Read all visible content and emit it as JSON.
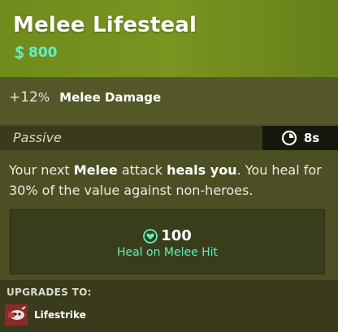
{
  "item": {
    "title": "Melee Lifesteal",
    "cost_value": "800",
    "cost_icon": "souls-currency-icon"
  },
  "stats": [
    {
      "value": "+12",
      "unit": "%",
      "label": "Melee Damage"
    }
  ],
  "passive": {
    "label": "Passive",
    "cooldown": "8s",
    "cooldown_icon": "cooldown-timer-icon"
  },
  "description": {
    "part1": "Your next ",
    "bold1": "Melee",
    "part2": " attack ",
    "bold2": "heals you",
    "part3": ". You heal for 30% of the value against non-heroes."
  },
  "heal": {
    "icon": "heart-icon",
    "value": "100",
    "label": "Heal on Melee Hit"
  },
  "upgrades": {
    "title": "UPGRADES TO:",
    "items": [
      {
        "label": "Lifestrike",
        "icon": "lifestrike-icon"
      }
    ]
  },
  "colors": {
    "header_green": "#7a9420",
    "teal_accent": "#61f0c4",
    "card_bg": "#4b4f23",
    "dark_bar": "#393b1c"
  }
}
